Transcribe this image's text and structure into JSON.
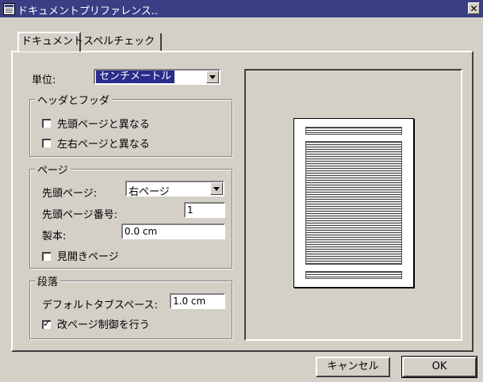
{
  "window": {
    "title": "ドキュメントプリファレンス..",
    "close_label": "✕"
  },
  "tabs": [
    {
      "label": "ドキュメント"
    },
    {
      "label": "スペルチェック"
    }
  ],
  "units": {
    "label": "単位:",
    "value": "センチメートル"
  },
  "header_footer": {
    "title": "ヘッダとフッダ",
    "first_page_diff": {
      "label": "先頭ページと異なる",
      "checked": false
    },
    "left_right_diff": {
      "label": "左右ページと異なる",
      "checked": false
    }
  },
  "page": {
    "title": "ページ",
    "first_page_label": "先頭ページ:",
    "first_page_value": "右ページ",
    "first_page_number_label": "先頭ページ番号:",
    "first_page_number_value": "1",
    "binding_label": "製本:",
    "binding_value": "0.0 cm",
    "facing_pages": {
      "label": "見開きページ",
      "checked": false
    }
  },
  "paragraph": {
    "title": "段落",
    "default_tab_label": "デフォルトタブスペース:",
    "default_tab_value": "1.0 cm",
    "page_break_control": {
      "label": "改ページ制御を行う",
      "checked": true
    }
  },
  "buttons": {
    "cancel": "キャンセル",
    "ok": "OK"
  },
  "colors": {
    "title_bar": "#3a3f84",
    "dialog_bg": "#d4d0c8",
    "selection": "#2b2c8c"
  }
}
